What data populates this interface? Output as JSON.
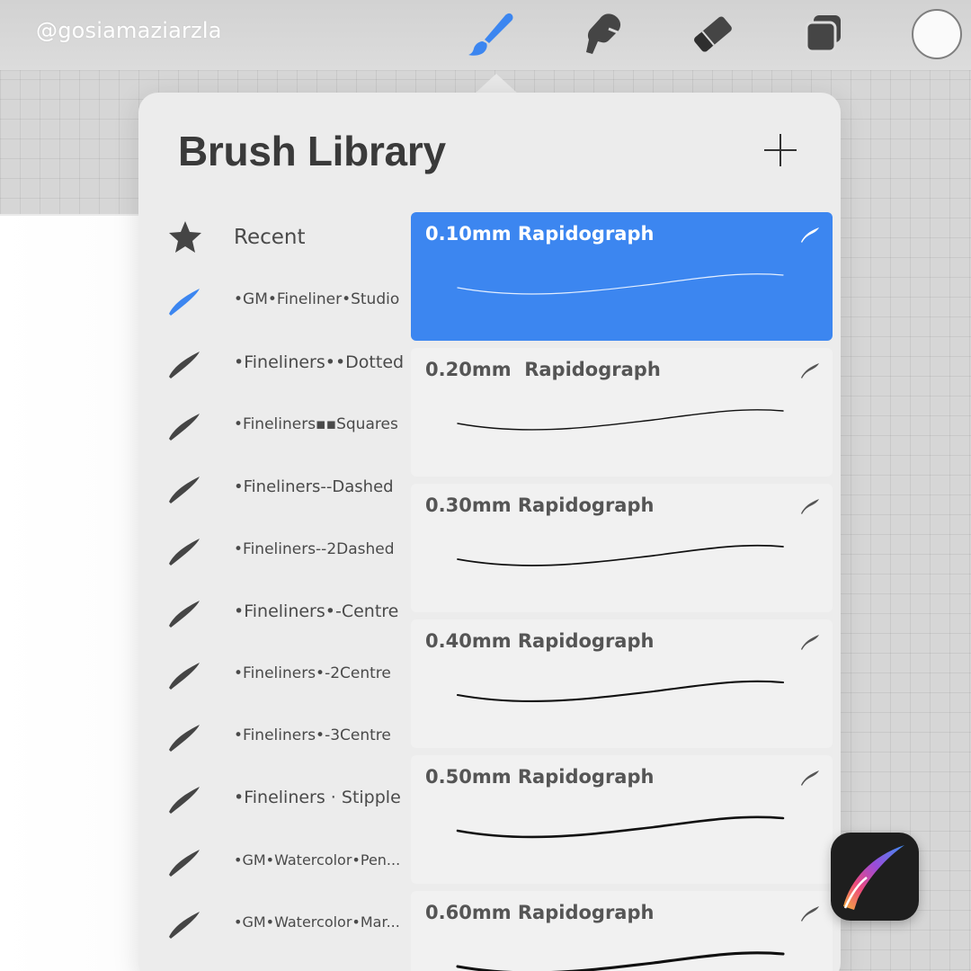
{
  "handle": "@gosiamaziarzla",
  "toolbar": {
    "tools": [
      {
        "icon": "brush-icon",
        "active": true
      },
      {
        "icon": "smudge-icon",
        "active": false
      },
      {
        "icon": "eraser-icon",
        "active": false
      },
      {
        "icon": "layers-icon",
        "active": false
      }
    ],
    "color": "#fafafa"
  },
  "library": {
    "title": "Brush Library",
    "add_icon": "plus-icon",
    "sets": [
      {
        "label": "Recent",
        "icon": "star-icon",
        "selected": false
      },
      {
        "label": "•GM•Fineliner•Studio",
        "icon": "brush-stroke-icon",
        "selected": true
      },
      {
        "label": "•Fineliners••Dotted",
        "icon": "brush-stroke-icon",
        "selected": false
      },
      {
        "label": "•Fineliners▪▪Squares",
        "icon": "brush-stroke-icon",
        "selected": false
      },
      {
        "label": "•Fineliners--Dashed",
        "icon": "brush-stroke-icon",
        "selected": false
      },
      {
        "label": "•Fineliners--2Dashed",
        "icon": "brush-stroke-icon",
        "selected": false
      },
      {
        "label": "•Fineliners•-Centre",
        "icon": "brush-stroke-icon",
        "selected": false
      },
      {
        "label": "•Fineliners•-2Centre",
        "icon": "brush-stroke-icon",
        "selected": false
      },
      {
        "label": "•Fineliners•-3Centre",
        "icon": "brush-stroke-icon",
        "selected": false
      },
      {
        "label": "•Fineliners · Stipple",
        "icon": "brush-stroke-icon",
        "selected": false
      },
      {
        "label": "•GM•Watercolor•Pen...",
        "icon": "brush-stroke-icon",
        "selected": false
      },
      {
        "label": "•GM•Watercolor•Mar...",
        "icon": "brush-stroke-icon",
        "selected": false
      }
    ],
    "brushes": [
      {
        "name": "0.10mm Rapidograph",
        "selected": true
      },
      {
        "name": "0.20mm  Rapidograph",
        "selected": false
      },
      {
        "name": "0.30mm Rapidograph",
        "selected": false
      },
      {
        "name": "0.40mm Rapidograph",
        "selected": false
      },
      {
        "name": "0.50mm Rapidograph",
        "selected": false
      },
      {
        "name": "0.60mm Rapidograph",
        "selected": false
      }
    ]
  },
  "colors": {
    "accent": "#3c86f0",
    "icon_dark": "#454545"
  },
  "app_icon": "procreate-app-icon"
}
